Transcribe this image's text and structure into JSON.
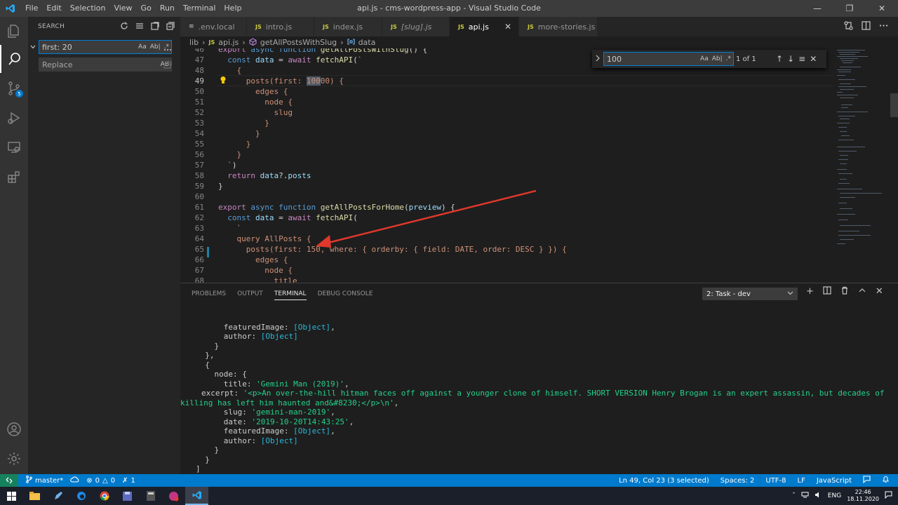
{
  "window": {
    "title": "api.js - cms-wordpress-app - Visual Studio Code",
    "menu": [
      "File",
      "Edit",
      "Selection",
      "View",
      "Go",
      "Run",
      "Terminal",
      "Help"
    ]
  },
  "activity": {
    "scm_badge": "5"
  },
  "sidebar": {
    "title": "SEARCH",
    "search_value": "first: 20",
    "replace_placeholder": "Replace",
    "search_opts": [
      "Aa",
      "Ab|",
      ".*"
    ],
    "replace_opt": "AB"
  },
  "tabs": [
    {
      "label": ".env.local",
      "kind": "env"
    },
    {
      "label": "intro.js",
      "kind": "js"
    },
    {
      "label": "index.js",
      "kind": "js"
    },
    {
      "label": "[slug].js",
      "kind": "js"
    },
    {
      "label": "api.js",
      "kind": "js",
      "active": true
    },
    {
      "label": "more-stories.js",
      "kind": "js"
    }
  ],
  "tab_icon_js": "JS",
  "tab_icon_env": "≡",
  "breadcrumb": {
    "parts": [
      "lib",
      "api.js",
      "getAllPostsWithSlug",
      "data"
    ]
  },
  "find": {
    "value": "100",
    "count": "1 of 1",
    "opts": [
      "Aa",
      "Ab|",
      ".*"
    ]
  },
  "editor": {
    "lines": [
      {
        "n": "46",
        "code": "export async function getAllPostsWithSlug() {"
      },
      {
        "n": "47",
        "code": "  const data = await fetchAPI(`"
      },
      {
        "n": "48",
        "code": "    {"
      },
      {
        "n": "49",
        "code": "      posts(first: 10000) {"
      },
      {
        "n": "50",
        "code": "        edges {"
      },
      {
        "n": "51",
        "code": "          node {"
      },
      {
        "n": "52",
        "code": "            slug"
      },
      {
        "n": "53",
        "code": "          }"
      },
      {
        "n": "54",
        "code": "        }"
      },
      {
        "n": "55",
        "code": "      }"
      },
      {
        "n": "56",
        "code": "    }"
      },
      {
        "n": "57",
        "code": "  `)"
      },
      {
        "n": "58",
        "code": "  return data?.posts"
      },
      {
        "n": "59",
        "code": "}"
      },
      {
        "n": "60",
        "code": ""
      },
      {
        "n": "61",
        "code": "export async function getAllPostsForHome(preview) {"
      },
      {
        "n": "62",
        "code": "  const data = await fetchAPI("
      },
      {
        "n": "63",
        "code": "    `"
      },
      {
        "n": "64",
        "code": "    query AllPosts {"
      },
      {
        "n": "65",
        "code": "      posts(first: 150, where: { orderby: { field: DATE, order: DESC } }) {"
      },
      {
        "n": "66",
        "code": "        edges {"
      },
      {
        "n": "67",
        "code": "          node {"
      },
      {
        "n": "68",
        "code": "            title"
      }
    ]
  },
  "panel": {
    "tabs": [
      "PROBLEMS",
      "OUTPUT",
      "TERMINAL",
      "DEBUG CONSOLE"
    ],
    "active_tab": "TERMINAL",
    "task": "2: Task - dev",
    "terminal": {
      "l1_key": "      featuredImage: ",
      "l1_val": "[Object]",
      "l1_end": ",",
      "l2_key": "      author: ",
      "l2_val": "[Object]",
      "l3": "    }",
      "l4": "  },",
      "l5": "  {",
      "l6": "    node: {",
      "title_key": "      title: ",
      "title_val": "'Gemini Man (2019)'",
      "title_end": ",",
      "excerpt_key": "excerpt: ",
      "excerpt_val": "'<p>An over-the-hill hitman faces off against a younger clone of himself. SHORT VERSION Henry Brogan is an expert assassin, but decades of killing has left him haunted and&#8230;</p>\\n'",
      "excerpt_end": ",",
      "slug_key": "      slug: ",
      "slug_val": "'gemini-man-2019'",
      "slug_end": ",",
      "date_key": "      date: ",
      "date_val": "'2019-10-20T14:43:25'",
      "date_end": ",",
      "fi_key": "      featuredImage: ",
      "fi_val": "[Object]",
      "fi_end": ",",
      "au_key": "      author: ",
      "au_val": "[Object]",
      "c1": "    }",
      "c2": "  }",
      "c3": "]"
    }
  },
  "status": {
    "branch": "master*",
    "errors": "0",
    "warnings": "0",
    "tasks": "1",
    "position": "Ln 49, Col 23 (3 selected)",
    "spaces": "Spaces: 2",
    "encoding": "UTF-8",
    "eol": "LF",
    "language": "JavaScript"
  },
  "taskbar": {
    "lang": "ENG",
    "time": "22:46",
    "date": "18.11.2020"
  },
  "colors": {
    "accent": "#007acc",
    "arrow": "#e0382c"
  }
}
